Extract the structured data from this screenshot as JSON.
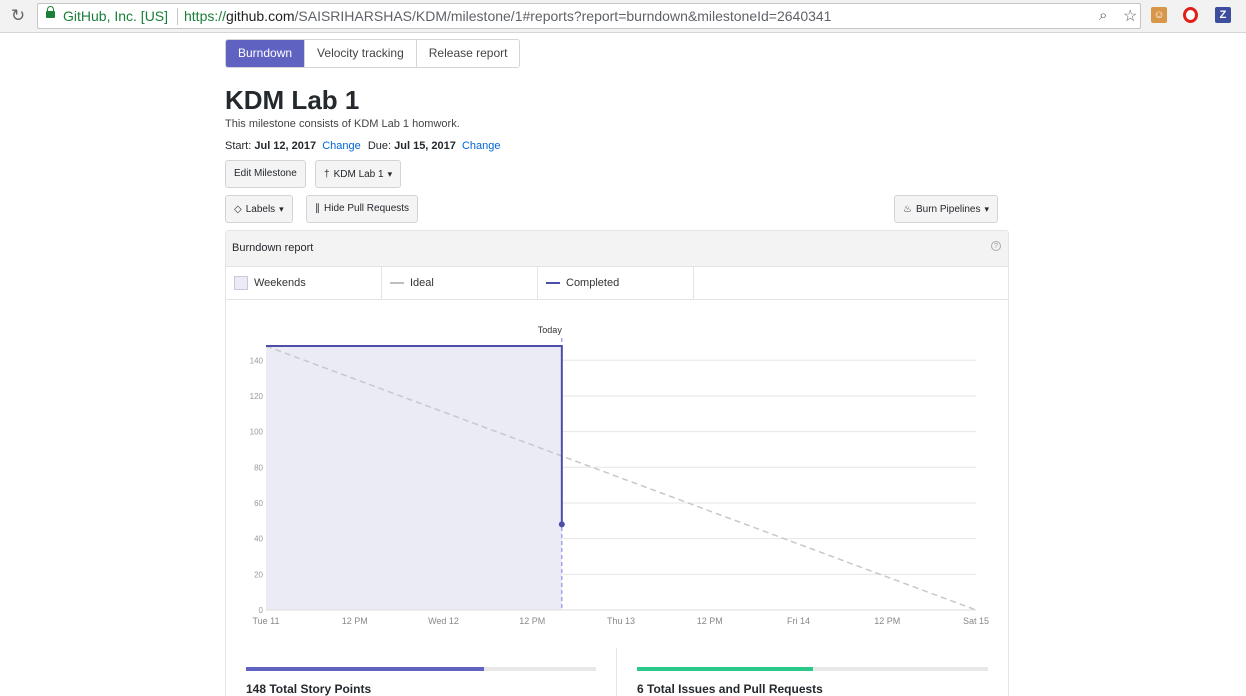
{
  "browser": {
    "site_identity": "GitHub, Inc. [US]",
    "url_scheme": "https://",
    "url_host": "github.com",
    "url_path": "/SAISRIHARSHAS/KDM/milestone/1#reports?report=burndown&milestoneId=2640341",
    "ext_z": "Z"
  },
  "tabs": [
    {
      "label": "Burndown",
      "active": true
    },
    {
      "label": "Velocity tracking",
      "active": false
    },
    {
      "label": "Release report",
      "active": false
    }
  ],
  "milestone": {
    "title": "KDM Lab 1",
    "description": "This milestone consists of KDM Lab 1 homwork.",
    "start_label": "Start:",
    "start_date": "Jul 12, 2017",
    "due_label": "Due:",
    "due_date": "Jul 15, 2017",
    "change_label": "Change"
  },
  "buttons": {
    "edit_milestone": "Edit Milestone",
    "milestone_select": "KDM Lab 1",
    "labels": "Labels",
    "hide_prs": "Hide Pull Requests",
    "burn_pipelines": "Burn Pipelines"
  },
  "report": {
    "title": "Burndown report",
    "help": "?",
    "legend": [
      {
        "label": "Weekends",
        "kind": "swatch"
      },
      {
        "label": "Ideal",
        "kind": "ideal"
      },
      {
        "label": "Completed",
        "kind": "completed"
      }
    ],
    "today_label": "Today"
  },
  "colors": {
    "accent": "#6062c2",
    "completed_line": "#4c4ea8",
    "area_fill": "#ebebf6",
    "ideal_line": "#c8c8c8",
    "green": "#28c989"
  },
  "chart_data": {
    "type": "line",
    "x_ticks": [
      "Tue 11",
      "12 PM",
      "Wed 12",
      "12 PM",
      "Thu 13",
      "12 PM",
      "Fri 14",
      "12 PM",
      "Sat 15"
    ],
    "y_ticks": [
      0,
      20,
      40,
      60,
      80,
      100,
      120,
      140
    ],
    "ylim": [
      0,
      148
    ],
    "x_range_hours": [
      0,
      96
    ],
    "series": [
      {
        "name": "Completed",
        "points": [
          [
            0,
            148
          ],
          [
            40,
            148
          ],
          [
            40,
            48
          ]
        ]
      },
      {
        "name": "Ideal",
        "points": [
          [
            0,
            148
          ],
          [
            96,
            0
          ]
        ]
      }
    ],
    "today_hours": 40
  },
  "stats": [
    {
      "label": "148 Total Story Points",
      "progress": 0.68
    },
    {
      "label": "6 Total Issues and Pull Requests",
      "progress": 0.5
    }
  ]
}
